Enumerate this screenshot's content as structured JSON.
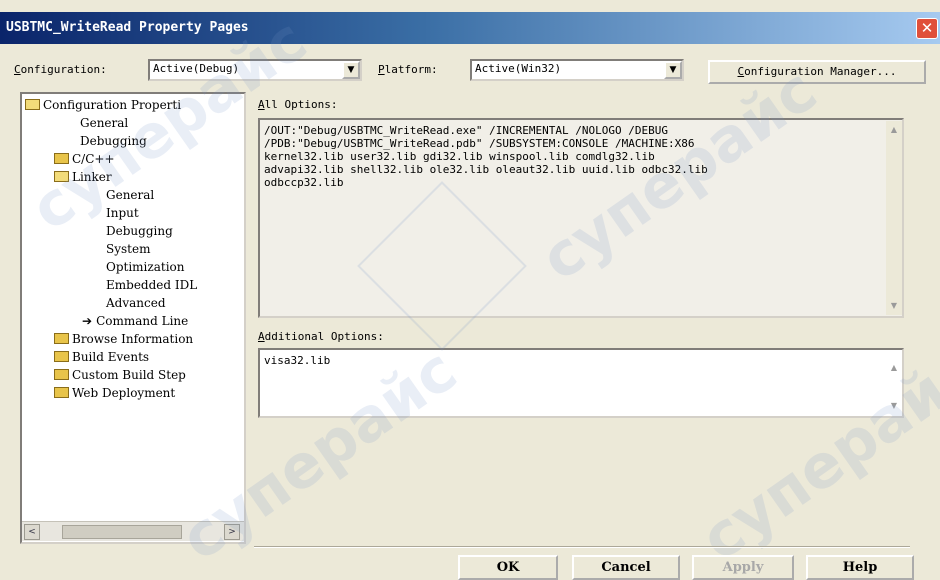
{
  "window": {
    "title": "USBTMC_WriteRead Property Pages",
    "close_glyph": "✕"
  },
  "config_bar": {
    "configuration_label_prefix": "C",
    "configuration_label_rest": "onfiguration:",
    "configuration_value": "Active(Debug)",
    "platform_label_prefix": "P",
    "platform_label_rest": "latform:",
    "platform_value": "Active(Win32)",
    "dropdown_glyph": "▼",
    "manager_button_prefix": "C",
    "manager_button_rest": "onfiguration Manager..."
  },
  "tree": {
    "items": [
      {
        "label": "Configuration Properti",
        "icon": "folder-open-icon"
      },
      {
        "label": "General"
      },
      {
        "label": "Debugging"
      },
      {
        "label": "C/C++",
        "icon": "folder-icon"
      },
      {
        "label": "Linker",
        "icon": "folder-open-icon"
      },
      {
        "label": "General"
      },
      {
        "label": "Input"
      },
      {
        "label": "Debugging"
      },
      {
        "label": "System"
      },
      {
        "label": "Optimization"
      },
      {
        "label": "Embedded IDL"
      },
      {
        "label": "Advanced"
      },
      {
        "label": "Command Line",
        "icon": "arrow-right-icon"
      },
      {
        "label": "Browse Information",
        "icon": "folder-icon"
      },
      {
        "label": "Build Events",
        "icon": "folder-icon"
      },
      {
        "label": "Custom Build Step",
        "icon": "folder-icon"
      },
      {
        "label": "Web Deployment",
        "icon": "folder-icon"
      }
    ],
    "scroll_left_glyph": "<",
    "scroll_right_glyph": ">"
  },
  "all_options": {
    "label_prefix": "A",
    "label_rest": "ll Options:",
    "text": "/OUT:\"Debug/USBTMC_WriteRead.exe\" /INCREMENTAL /NOLOGO /DEBUG\n/PDB:\"Debug/USBTMC_WriteRead.pdb\" /SUBSYSTEM:CONSOLE /MACHINE:X86\nkernel32.lib user32.lib gdi32.lib winspool.lib comdlg32.lib\nadvapi32.lib shell32.lib ole32.lib oleaut32.lib uuid.lib odbc32.lib\nodbccp32.lib"
  },
  "additional_options": {
    "label_prefix": "A",
    "label_rest": "dditional Options:",
    "text": "visa32.lib"
  },
  "scroll_glyphs": {
    "up": "▲",
    "down": "▼"
  },
  "buttons": {
    "ok": "OK",
    "cancel": "Cancel",
    "apply": "Apply",
    "help": "Help"
  },
  "watermark": {
    "text": "суперайс"
  }
}
